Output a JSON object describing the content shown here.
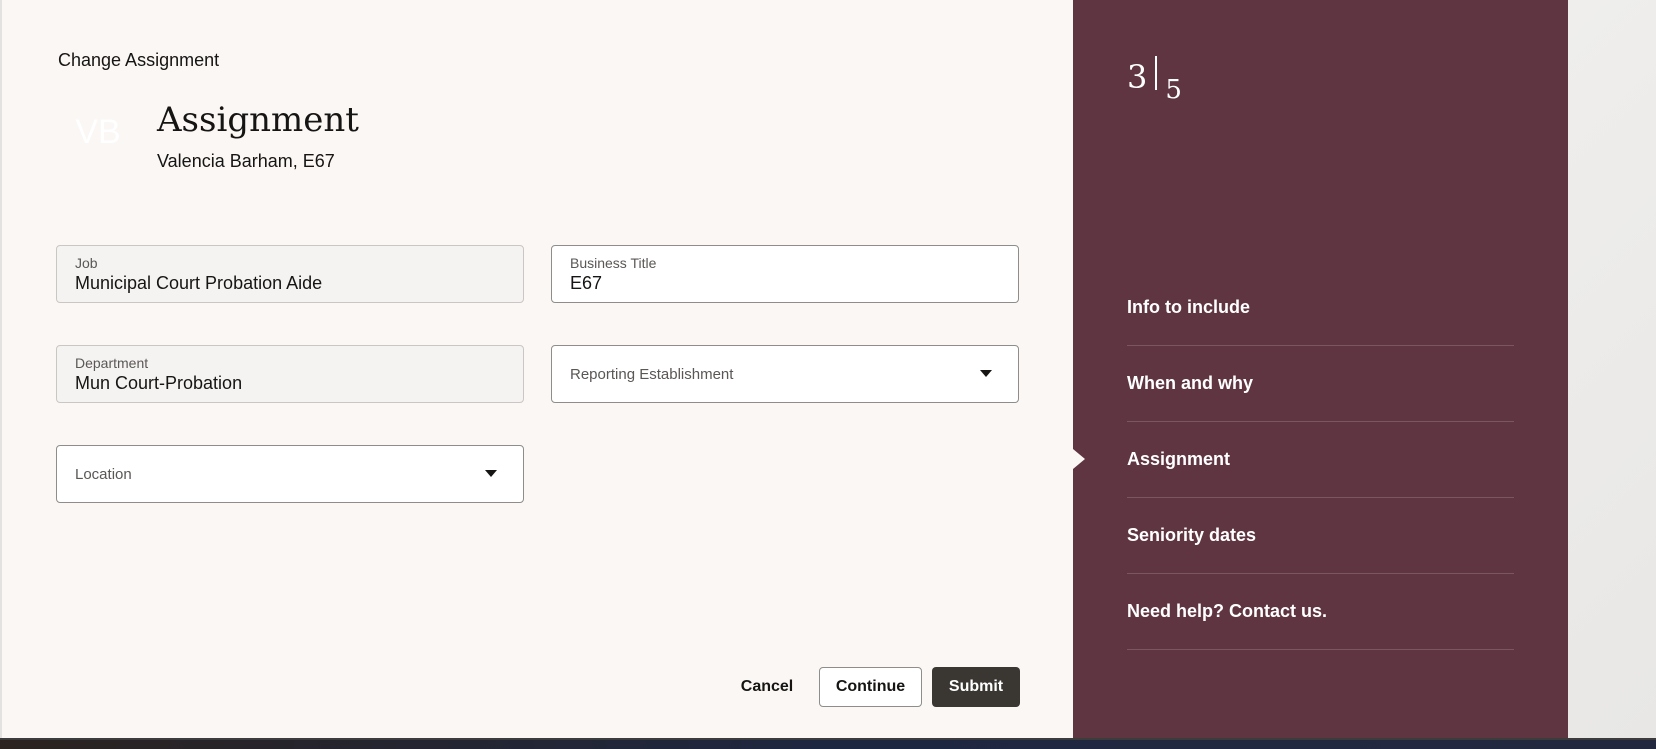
{
  "header": {
    "breadcrumb": "Change Assignment",
    "avatar_initials": "VB",
    "title": "Assignment",
    "subtitle": "Valencia Barham, E67"
  },
  "form": {
    "job": {
      "label": "Job",
      "value": "Municipal Court Probation Aide"
    },
    "business_title": {
      "label": "Business Title",
      "value": "E67"
    },
    "department": {
      "label": "Department",
      "value": "Mun Court-Probation"
    },
    "reporting_establishment": {
      "placeholder": "Reporting Establishment"
    },
    "location": {
      "placeholder": "Location"
    }
  },
  "actions": {
    "cancel": "Cancel",
    "continue": "Continue",
    "submit": "Submit"
  },
  "progress": {
    "current": "3",
    "total": "5"
  },
  "nav": {
    "items": [
      {
        "label": "Info to include"
      },
      {
        "label": "When and why"
      },
      {
        "label": "Assignment"
      },
      {
        "label": "Seniority dates"
      },
      {
        "label": "Need help? Contact us."
      }
    ],
    "active_index": 2
  },
  "colors": {
    "panel": "#5e3540",
    "submit": "#3a3632"
  }
}
